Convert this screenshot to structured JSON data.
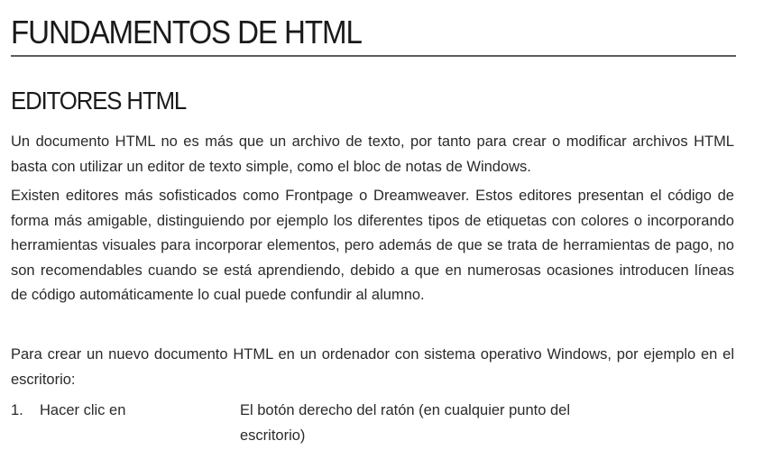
{
  "document": {
    "main_title": "FUNDAMENTOS DE HTML",
    "section_title": "EDITORES HTML",
    "paragraphs": [
      "Un documento HTML no es más que un archivo de texto, por tanto para crear o modificar archivos HTML basta con utilizar un editor de texto simple, como el bloc de notas de Windows.",
      "Existen editores más sofisticados como Frontpage o Dreamweaver. Estos editores presentan el código de forma más amigable, distinguiendo por ejemplo los diferentes tipos de etiquetas con colores o incorporando herramientas visuales para incorporar elementos, pero además de que se trata de herramientas de pago, no son recomendables cuando se está aprendiendo, debido a que en numerosas ocasiones introducen líneas de código automáticamente lo cual puede confundir al alumno.",
      "Para crear un nuevo documento HTML en un ordenador con sistema operativo Windows, por ejemplo en el escritorio:"
    ],
    "steps": [
      {
        "number": "1.",
        "action": "Hacer clic en",
        "detail": "El botón derecho del ratón (en cualquier punto del escritorio)"
      }
    ]
  },
  "colors": {
    "text": "#2a2a2a",
    "heading": "#1a1a1a",
    "rule": "#5c5c5c",
    "background": "#ffffff"
  }
}
